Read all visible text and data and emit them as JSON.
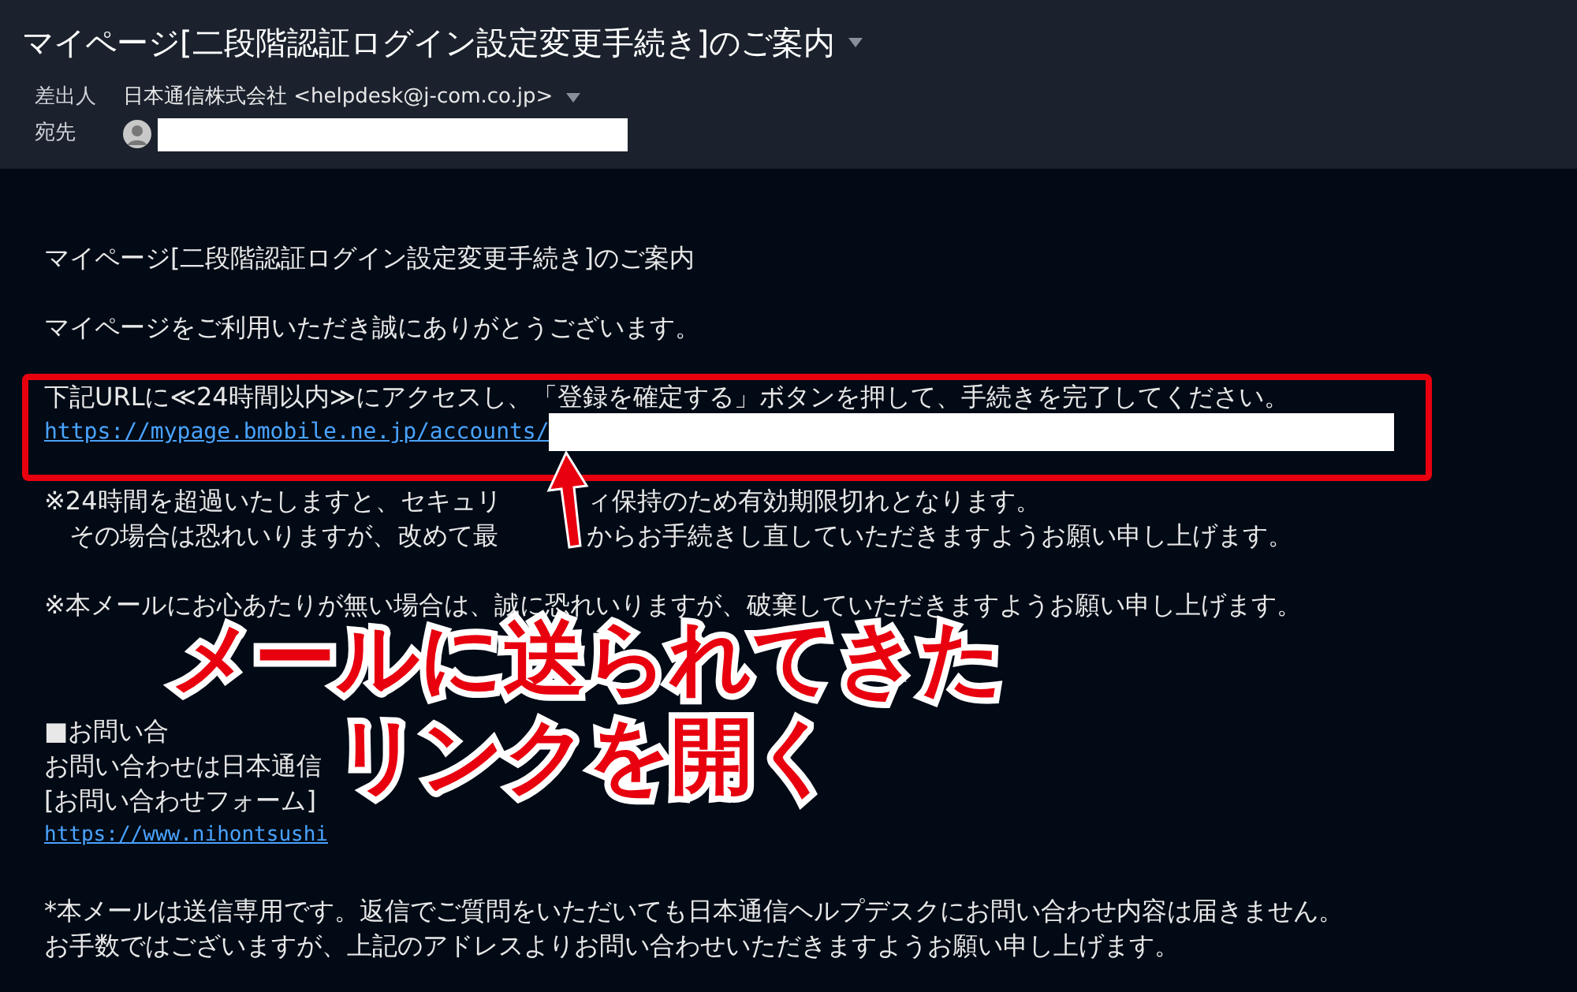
{
  "header": {
    "title": "マイページ[二段階認証ログイン設定変更手続き]のご案内",
    "from_label": "差出人",
    "from": "日本通信株式会社 <helpdesk@j-com.co.jp>",
    "to_label": "宛先"
  },
  "body": [
    {
      "lines": [
        {
          "kind": "text",
          "text": "マイページ[二段階認証ログイン設定変更手続き]のご案内"
        }
      ]
    },
    {
      "lines": [
        {
          "kind": "text",
          "text": "マイページをご利用いただき誠にありがとうございます。"
        }
      ]
    },
    {
      "highlighted": true,
      "lines": [
        {
          "kind": "text",
          "text": "下記URLに≪24時間以内≫にアクセスし、「登録を確定する」ボタンを押して、手続きを完了してください。"
        },
        {
          "kind": "redacted_link",
          "text": "https://mypage.bmobile.ne.jp/accounts/"
        }
      ]
    },
    {
      "lines": [
        {
          "kind": "split",
          "parts": [
            "※24時間を超過いたしますと、セキュリ",
            "ィ保持のため有効期限切れとなります。"
          ]
        },
        {
          "kind": "split",
          "parts": [
            "　その場合は恐れいりますが、改めて最",
            "からお手続きし直していただきますようお願い申し上げます。"
          ]
        }
      ]
    },
    {
      "lines": [
        {
          "kind": "text",
          "text": "※本メールにお心あたりが無い場合は、誠に恐れいりますが、破棄していただきますようお願い申し上げます。"
        }
      ]
    },
    {
      "lines": [
        {
          "kind": "text",
          "text": "■お問い合"
        },
        {
          "kind": "text",
          "text": "お問い合わせは日本通信"
        },
        {
          "kind": "text",
          "text": "[お問い合わせフォーム]"
        },
        {
          "kind": "link",
          "text": "https://www.nihontsushi"
        }
      ]
    },
    {
      "lines": [
        {
          "kind": "text",
          "text": "*本メールは送信専用です。返信でご質問をいただいても日本通信ヘルプデスクにお問い合わせ内容は届きません。"
        },
        {
          "kind": "text",
          "text": "お手数ではございますが、上記のアドレスよりお問い合わせいただきますようお願い申し上げます。"
        }
      ]
    }
  ],
  "annotation": {
    "lines": [
      "メールに送られてきた",
      "リンクを開く"
    ]
  }
}
